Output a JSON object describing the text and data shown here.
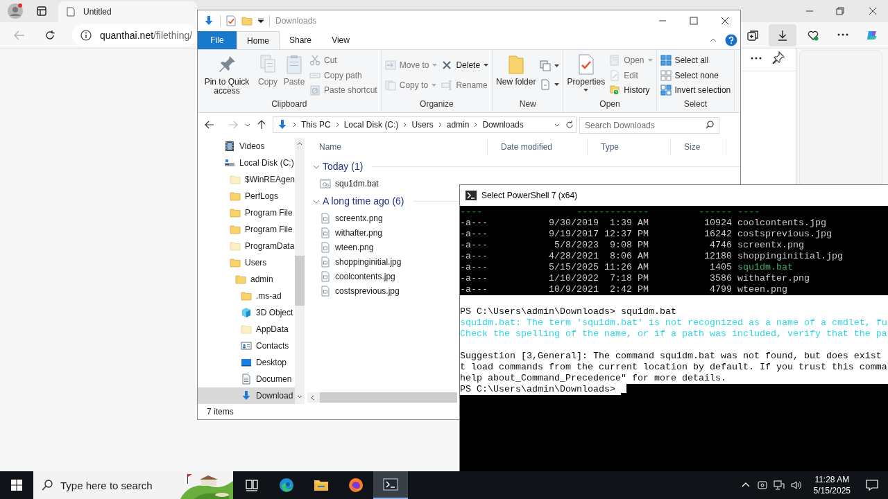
{
  "browser": {
    "tabs": [
      {
        "label": "Untitled",
        "selected": true
      }
    ],
    "url_host": "quanthai.net",
    "url_path": "/filething/"
  },
  "explorer": {
    "title": "Downloads",
    "ribbon_tabs": [
      {
        "label": "File",
        "kind": "file",
        "selected": false
      },
      {
        "label": "Home",
        "kind": "tab",
        "selected": true
      },
      {
        "label": "Share",
        "kind": "tab",
        "selected": false
      },
      {
        "label": "View",
        "kind": "tab",
        "selected": false
      }
    ],
    "ribbon_groups": [
      {
        "label": "Clipboard",
        "columns": [
          {
            "kind": "large",
            "items": [
              {
                "label": "Pin to Quick access",
                "kind": "pin",
                "disabled": false
              }
            ]
          },
          {
            "kind": "large",
            "items": [
              {
                "label": "Copy",
                "kind": "copy",
                "disabled": true
              }
            ]
          },
          {
            "kind": "large",
            "items": [
              {
                "label": "Paste",
                "kind": "paste",
                "disabled": true
              }
            ]
          },
          {
            "kind": "small",
            "items": [
              {
                "label": "Cut",
                "kind": "cut",
                "disabled": true
              },
              {
                "label": "Copy path",
                "kind": "copy-path",
                "disabled": true
              },
              {
                "label": "Paste shortcut",
                "kind": "paste-shortcut",
                "disabled": true
              }
            ]
          }
        ]
      },
      {
        "label": "Organize",
        "columns": [
          {
            "kind": "small",
            "items": [
              {
                "label": "Move to",
                "kind": "move",
                "disabled": true,
                "dropdown": true
              },
              {
                "label": "Copy to",
                "kind": "copy-to",
                "disabled": true,
                "dropdown": true
              }
            ]
          },
          {
            "kind": "small",
            "items": [
              {
                "label": "Delete",
                "kind": "delete",
                "disabled": false,
                "dropdown": true
              },
              {
                "label": "Rename",
                "kind": "rename",
                "disabled": true
              }
            ]
          }
        ]
      },
      {
        "label": "New",
        "columns": [
          {
            "kind": "large",
            "items": [
              {
                "label": "New folder",
                "kind": "new-folder",
                "disabled": false
              }
            ]
          },
          {
            "kind": "small",
            "items": [
              {
                "kind": "new-item",
                "disabled": false,
                "dropdown": true
              },
              {
                "kind": "easy-access",
                "disabled": false,
                "dropdown": true
              }
            ]
          }
        ]
      },
      {
        "label": "Open",
        "columns": [
          {
            "kind": "large",
            "items": [
              {
                "label": "Properties",
                "kind": "properties",
                "disabled": false,
                "dropdown": true
              }
            ]
          },
          {
            "kind": "small",
            "items": [
              {
                "label": "Open",
                "kind": "open",
                "disabled": true,
                "dropdown": true
              },
              {
                "label": "Edit",
                "kind": "edit",
                "disabled": true
              },
              {
                "label": "History",
                "kind": "history",
                "disabled": false
              }
            ]
          }
        ]
      },
      {
        "label": "Select",
        "columns": [
          {
            "kind": "small",
            "items": [
              {
                "label": "Select all",
                "kind": "select-all",
                "disabled": false
              },
              {
                "label": "Select none",
                "kind": "select-none",
                "disabled": false
              },
              {
                "label": "Invert selection",
                "kind": "invert",
                "disabled": false
              }
            ]
          }
        ]
      }
    ],
    "address": [
      "This PC",
      "Local Disk (C:)",
      "Users",
      "admin",
      "Downloads"
    ],
    "search": {
      "placeholder": "Search Downloads"
    },
    "nav": [
      {
        "label": "Videos",
        "kind": "videos",
        "selected": false
      },
      {
        "label": "Local Disk (C:)",
        "kind": "drive",
        "selected": false,
        "children": [
          {
            "label": "$WinREAgen",
            "kind": "folder-pale",
            "selected": false
          },
          {
            "label": "PerfLogs",
            "kind": "folder",
            "selected": false
          },
          {
            "label": "Program File",
            "kind": "folder",
            "selected": false
          },
          {
            "label": "Program File",
            "kind": "folder",
            "selected": false
          },
          {
            "label": "ProgramData",
            "kind": "folder-pale",
            "selected": false
          },
          {
            "label": "Users",
            "kind": "folder",
            "selected": false,
            "children": [
              {
                "label": "admin",
                "kind": "folder",
                "selected": false,
                "children": [
                  {
                    "label": ".ms-ad",
                    "kind": "folder",
                    "selected": false
                  },
                  {
                    "label": "3D Object",
                    "kind": "objects",
                    "selected": false
                  },
                  {
                    "label": "AppData",
                    "kind": "folder-pale",
                    "selected": false
                  },
                  {
                    "label": "Contacts",
                    "kind": "contacts",
                    "selected": false
                  },
                  {
                    "label": "Desktop",
                    "kind": "desktop",
                    "selected": false
                  },
                  {
                    "label": "Documen",
                    "kind": "documents",
                    "selected": false
                  },
                  {
                    "label": "Download",
                    "kind": "downloads",
                    "selected": true
                  }
                ]
              }
            ]
          }
        ]
      }
    ],
    "columns": [
      "Name",
      "Date modified",
      "Type",
      "Size"
    ],
    "groups": [
      {
        "label": "Today (1)",
        "files": [
          {
            "name": "squ1dm.bat",
            "kind": "batch"
          }
        ]
      },
      {
        "label": "A long time ago (6)",
        "files": [
          {
            "name": "screentx.png",
            "kind": "image"
          },
          {
            "name": "withafter.png",
            "kind": "image"
          },
          {
            "name": "wteen.png",
            "kind": "image"
          },
          {
            "name": "shoppinginitial.jpg",
            "kind": "image"
          },
          {
            "name": "coolcontents.jpg",
            "kind": "image"
          },
          {
            "name": "costsprevious.jpg",
            "kind": "image"
          }
        ]
      }
    ],
    "status": "7 items"
  },
  "powershell": {
    "title": "Select PowerShell 7 (x64)",
    "lines": [
      {
        "kind": "output",
        "segments": [
          {
            "kind": "header",
            "text": "----                 -------------         ------ ----"
          }
        ]
      },
      {
        "kind": "output",
        "segments": [
          {
            "kind": "plain",
            "text": "-a---           9/30/2019  1:39 AM          10924 coolcontents.jpg"
          }
        ]
      },
      {
        "kind": "output",
        "segments": [
          {
            "kind": "plain",
            "text": "-a---           9/19/2017 12:37 PM          16242 costsprevious.jpg"
          }
        ]
      },
      {
        "kind": "output",
        "segments": [
          {
            "kind": "plain",
            "text": "-a---            5/8/2023  9:08 PM           4746 screentx.png"
          }
        ]
      },
      {
        "kind": "output",
        "segments": [
          {
            "kind": "plain",
            "text": "-a---           4/28/2021  8:06 AM          12180 shoppinginitial.jpg"
          }
        ]
      },
      {
        "kind": "output",
        "segments": [
          {
            "kind": "plain",
            "text": "-a---           5/15/2025 11:26 AM           1405 "
          },
          {
            "kind": "executable",
            "text": "squ1dm.bat"
          }
        ]
      },
      {
        "kind": "output",
        "segments": [
          {
            "kind": "plain",
            "text": "-a---           1/10/2022  7:18 PM           3586 withafter.png"
          }
        ]
      },
      {
        "kind": "output",
        "segments": [
          {
            "kind": "plain",
            "text": "-a---           10/9/2021  2:42 PM           4799 wteen.png"
          }
        ]
      },
      {
        "kind": "selected"
      },
      {
        "kind": "selected",
        "segments": [
          {
            "kind": "plain",
            "text": "PS C:\\Users\\admin\\Downloads> squ1dm.bat"
          }
        ]
      },
      {
        "kind": "selected",
        "segments": [
          {
            "kind": "error",
            "text": "squ1dm.bat: The term 'squ1dm.bat' is not recognized as a name of a cmdlet, fu"
          }
        ]
      },
      {
        "kind": "selected",
        "segments": [
          {
            "kind": "error",
            "text": "Check the spelling of the name, or if a path was included, verify that the pa"
          }
        ]
      },
      {
        "kind": "selected"
      },
      {
        "kind": "selected",
        "segments": [
          {
            "kind": "plain",
            "text": "Suggestion [3,General]: The command squ1dm.bat was not found, but does exist"
          }
        ]
      },
      {
        "kind": "selected",
        "segments": [
          {
            "kind": "plain",
            "text": "t load commands from the current location by default. If you trust this comma"
          }
        ]
      },
      {
        "kind": "selected",
        "segments": [
          {
            "kind": "plain",
            "text": "help about_Command_Precedence\" for more details."
          }
        ]
      },
      {
        "kind": "prompt",
        "cursor": true,
        "segments": [
          {
            "kind": "plain",
            "text": "PS C:\\Users\\admin\\Downloads>"
          }
        ]
      }
    ]
  },
  "taskbar": {
    "search": {
      "placeholder": "Type here to search"
    },
    "apps": [
      {
        "kind": "task-view",
        "selected": false
      },
      {
        "kind": "edge",
        "selected": false
      },
      {
        "kind": "explorer",
        "selected": false
      },
      {
        "kind": "firefox",
        "selected": false
      },
      {
        "kind": "terminal",
        "selected": true
      }
    ],
    "time": "11:28 AM",
    "date": "5/15/2025"
  }
}
